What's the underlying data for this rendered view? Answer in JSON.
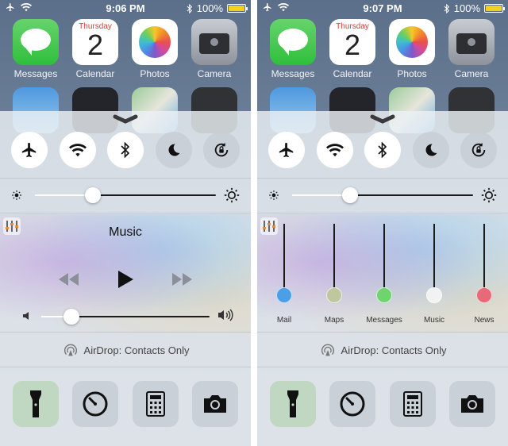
{
  "status": {
    "left": {
      "time": "9:06 PM",
      "battery": "100%"
    },
    "right": {
      "time": "9:07 PM",
      "battery": "100%"
    }
  },
  "apps": {
    "messages": "Messages",
    "calendar": "Calendar",
    "calendar_day": "Thursday",
    "calendar_date": "2",
    "photos": "Photos",
    "camera": "Camera"
  },
  "control_center": {
    "toggles": [
      {
        "name": "Airplane Mode",
        "icon": "airplane-icon",
        "on": true
      },
      {
        "name": "Wi-Fi",
        "icon": "wifi-icon",
        "on": true
      },
      {
        "name": "Bluetooth",
        "icon": "bluetooth-icon",
        "on": true
      },
      {
        "name": "Do Not Disturb",
        "icon": "moon-icon",
        "on": false
      },
      {
        "name": "Rotation Lock",
        "icon": "rotation-lock-icon",
        "on": false
      }
    ],
    "brightness": 0.32,
    "music_title": "Music",
    "volume": 0.18,
    "airdrop": "AirDrop: Contacts Only",
    "shortcuts": [
      "flashlight-icon",
      "timer-icon",
      "calculator-icon",
      "camera-icon"
    ],
    "mixer": [
      {
        "label": "Mail",
        "level": 0.0,
        "color": "#4a9fe6"
      },
      {
        "label": "Maps",
        "level": 0.0,
        "color": "#bfc79f"
      },
      {
        "label": "Messages",
        "level": 0.0,
        "color": "#6fd46d"
      },
      {
        "label": "Music",
        "level": 0.0,
        "color": "#f2f2f2"
      },
      {
        "label": "News",
        "level": 0.0,
        "color": "#e66a78"
      }
    ]
  },
  "colors": {
    "accent_on": "#ffffff",
    "toggle_off": "#c8ced6",
    "battery": "#f2d21b"
  }
}
